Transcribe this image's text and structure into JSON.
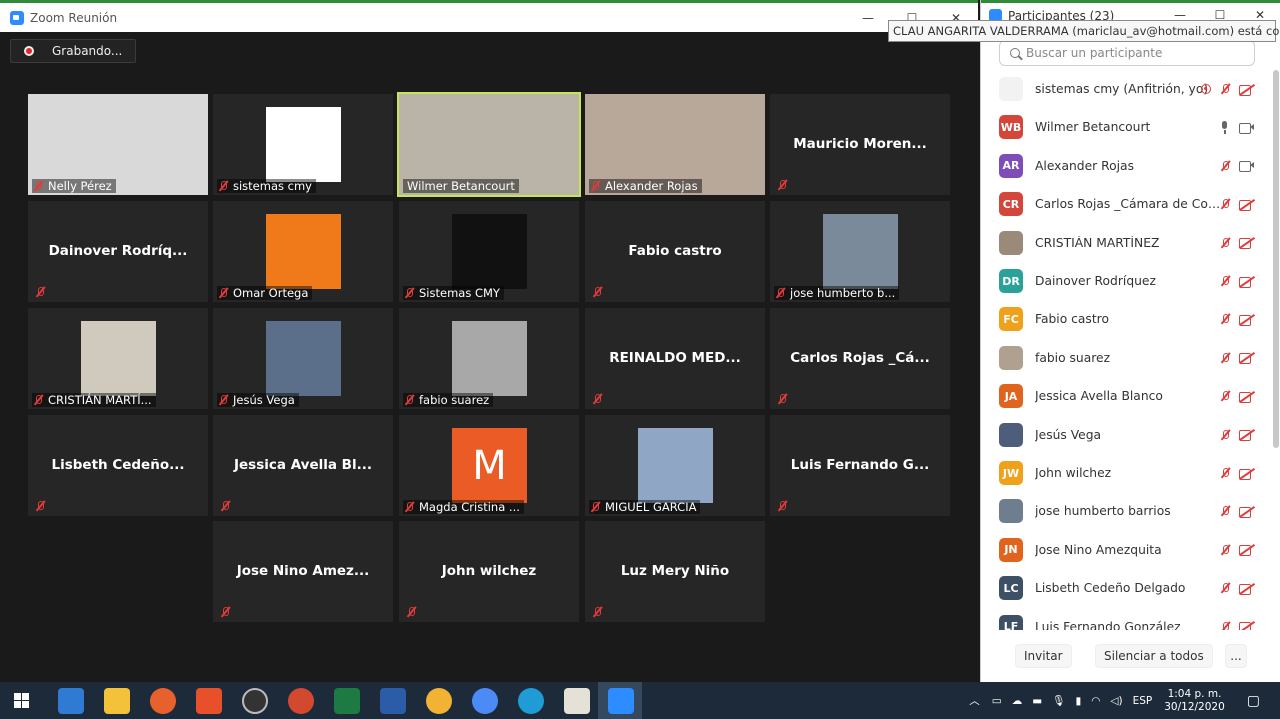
{
  "main_window": {
    "title": "Zoom Reunión",
    "recording_label": "Grabando..."
  },
  "tiles": [
    {
      "name": "Nelly Pérez",
      "type": "video",
      "bg": "#d9d9d9"
    },
    {
      "name": "sistemas cmy",
      "type": "picture",
      "bg": "#ffffff"
    },
    {
      "name": "Wilmer Betancourt",
      "type": "video",
      "bg": "#b9b3a8",
      "active": true,
      "unmuted": true
    },
    {
      "name": "Alexander Rojas",
      "type": "video",
      "bg": "#b7a89a"
    },
    {
      "name": "Mauricio  Moren...",
      "type": "name"
    },
    {
      "name": "Dainover  Rodríq...",
      "type": "name"
    },
    {
      "name": "Omar Ortega",
      "type": "picture",
      "bg": "#f07a1a"
    },
    {
      "name": "Sistemas CMY",
      "type": "picture",
      "bg": "#111111"
    },
    {
      "name": "Fabio castro",
      "type": "name"
    },
    {
      "name": "jose humberto b...",
      "type": "picture",
      "bg": "#7a8a9a"
    },
    {
      "name": "CRISTIÁN MARTÍ...",
      "type": "picture",
      "bg": "#cfcabd"
    },
    {
      "name": "Jesús Vega",
      "type": "picture",
      "bg": "#5b6f8a"
    },
    {
      "name": "fabio suarez",
      "type": "picture",
      "bg": "#a8a8a8"
    },
    {
      "name": "REINALDO  MED...",
      "type": "name"
    },
    {
      "name": "Carlos Rojas  _Cá...",
      "type": "name"
    },
    {
      "name": "Lisbeth  Cedeño...",
      "type": "name"
    },
    {
      "name": "Jessica Avella Bl...",
      "type": "name"
    },
    {
      "name": "Magda Cristina ...",
      "type": "letter",
      "bg": "#ea5b25",
      "letter": "M"
    },
    {
      "name": "MIGUEL GARCIA",
      "type": "picture",
      "bg": "#8fa6c4"
    },
    {
      "name": "Luis Fernando  G...",
      "type": "name"
    },
    {
      "name": "Jose Nino Amez...",
      "type": "name"
    },
    {
      "name": "John wilchez",
      "type": "name"
    },
    {
      "name": "Luz Mery Niño",
      "type": "name"
    }
  ],
  "panel": {
    "title": "Participantes (23)",
    "tooltip": "CLAU ANGARITA VALDERRAMA (mariclau_av@hotmail.com) está conectado",
    "search_placeholder": "Buscar un participante",
    "invite_label": "Invitar",
    "mute_all_label": "Silenciar a todos",
    "more_label": "...",
    "participants": [
      {
        "name": "sistemas cmy (Anfitrión, yo)",
        "initials": "",
        "color": "#f2f2f2",
        "photo": true,
        "recording": true
      },
      {
        "name": "Wilmer Betancourt",
        "initials": "WB",
        "color": "#d4453a",
        "mic_on": true,
        "video_on": true
      },
      {
        "name": "Alexander Rojas",
        "initials": "AR",
        "color": "#7e4db8",
        "video_on": true
      },
      {
        "name": "Carlos Rojas _Cámara de Comercio",
        "initials": "CR",
        "color": "#d4453a"
      },
      {
        "name": "CRISTIÁN MARTÍNEZ",
        "initials": "",
        "color": "#9a8a7a",
        "photo": true
      },
      {
        "name": "Dainover Rodríquez",
        "initials": "DR",
        "color": "#2aa29a"
      },
      {
        "name": "Fabio castro",
        "initials": "FC",
        "color": "#f0a11c"
      },
      {
        "name": "fabio suarez",
        "initials": "",
        "color": "#b0a090",
        "photo": true
      },
      {
        "name": "Jessica Avella Blanco",
        "initials": "JA",
        "color": "#e0641e"
      },
      {
        "name": "Jesús Vega",
        "initials": "",
        "color": "#4e5d7a",
        "photo": true
      },
      {
        "name": "John wilchez",
        "initials": "JW",
        "color": "#f0a11c"
      },
      {
        "name": "jose humberto barrios",
        "initials": "",
        "color": "#6e7e8e",
        "photo": true
      },
      {
        "name": "Jose Nino Amezquita",
        "initials": "JN",
        "color": "#e0641e"
      },
      {
        "name": "Lisbeth Cedeño Delgado",
        "initials": "LC",
        "color": "#3e5066"
      },
      {
        "name": "Luis Fernando González",
        "initials": "LF",
        "color": "#3e5066"
      }
    ]
  },
  "taskbar": {
    "language": "ESP",
    "time": "1:04 p. m.",
    "date": "30/12/2020"
  }
}
